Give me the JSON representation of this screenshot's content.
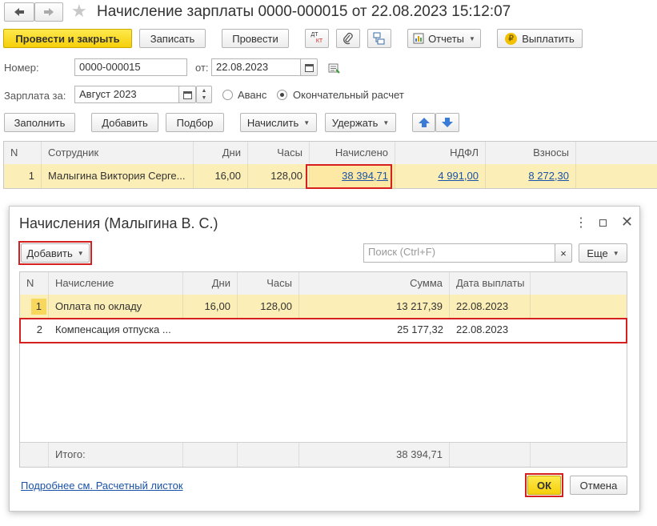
{
  "window": {
    "title": "Начисление зарплаты 0000-000015 от 22.08.2023 15:12:07"
  },
  "toolbar": {
    "post_close": "Провести и закрыть",
    "save": "Записать",
    "post": "Провести",
    "dtkt_top": "ДТ",
    "dtkt_bottom": "КТ",
    "reports": "Отчеты",
    "pay": "Выплатить"
  },
  "form": {
    "number_label": "Номер:",
    "number_value": "0000-000015",
    "date_label": "от:",
    "date_value": "22.08.2023",
    "salary_for_label": "Зарплата за:",
    "salary_for_value": "Август 2023",
    "advance_label": "Аванс",
    "final_label": "Окончательный расчет"
  },
  "actions": {
    "fill": "Заполнить",
    "add": "Добавить",
    "pick": "Подбор",
    "accrue": "Начислить",
    "withhold": "Удержать"
  },
  "main_table": {
    "headers": {
      "n": "N",
      "employee": "Сотрудник",
      "days": "Дни",
      "hours": "Часы",
      "accrued": "Начислено",
      "ndfl": "НДФЛ",
      "contrib": "Взносы"
    },
    "row": {
      "n": "1",
      "employee": "Малыгина Виктория Серге...",
      "days": "16,00",
      "hours": "128,00",
      "accrued": "38 394,71",
      "ndfl": "4 991,00",
      "contrib": "8 272,30"
    }
  },
  "dialog": {
    "title": "Начисления (Малыгина В. С.)",
    "add": "Добавить",
    "search_placeholder": "Поиск (Ctrl+F)",
    "clear": "×",
    "more": "Еще",
    "headers": {
      "n": "N",
      "accrual": "Начисление",
      "days": "Дни",
      "hours": "Часы",
      "sum": "Сумма",
      "paydate": "Дата выплаты"
    },
    "rows": [
      {
        "n": "1",
        "accrual": "Оплата по окладу",
        "days": "16,00",
        "hours": "128,00",
        "sum": "13 217,39",
        "paydate": "22.08.2023"
      },
      {
        "n": "2",
        "accrual": "Компенсация отпуска ...",
        "days": "",
        "hours": "",
        "sum": "25 177,32",
        "paydate": "22.08.2023"
      }
    ],
    "footer_label": "Итого:",
    "footer_sum": "38 394,71",
    "payslip_link": "Подробнее см. Расчетный листок",
    "ok": "ОК",
    "cancel": "Отмена"
  }
}
